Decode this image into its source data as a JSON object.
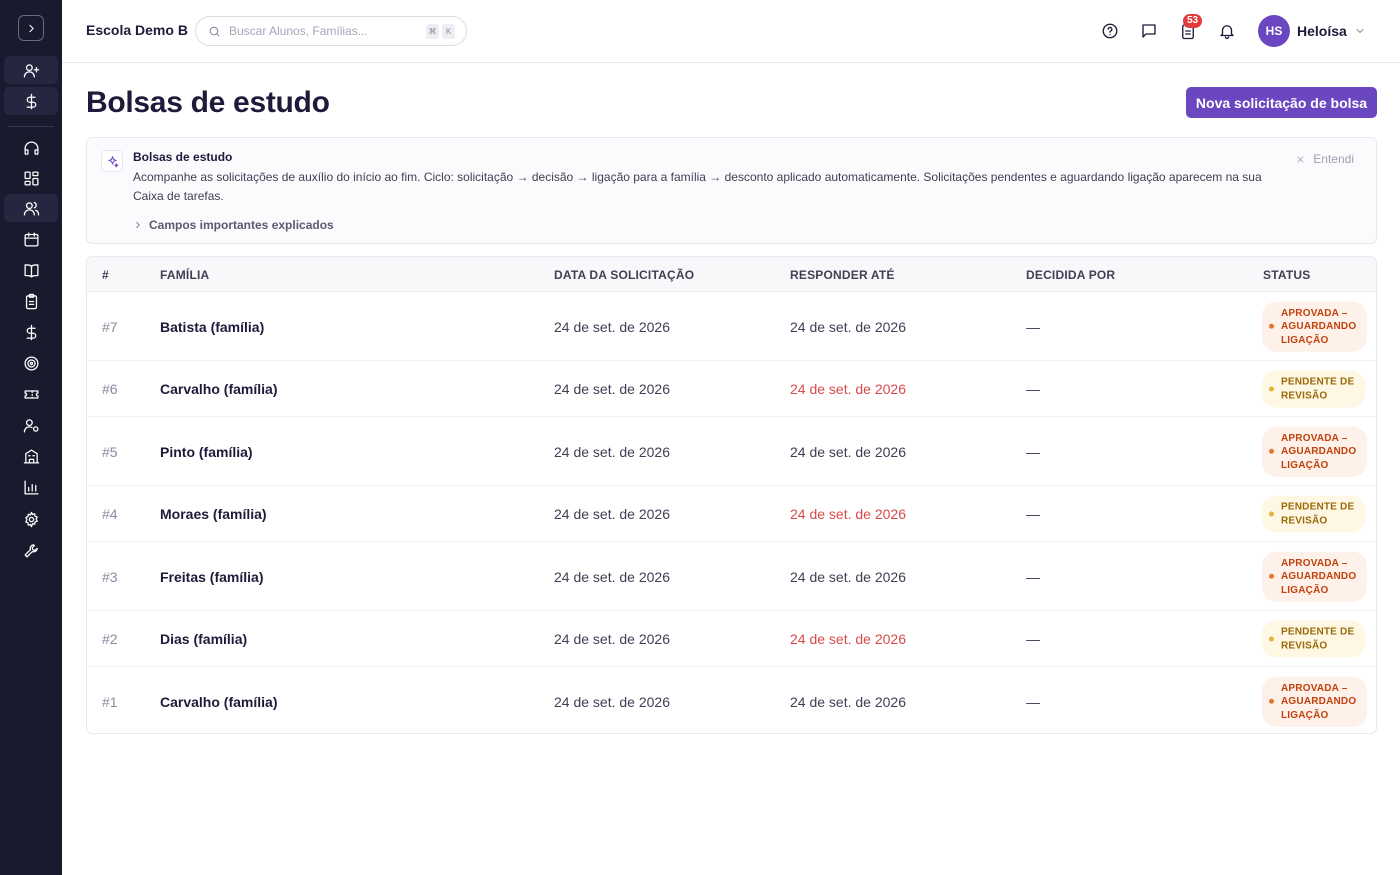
{
  "sidebar": {
    "items": [
      {
        "icon": "user-plus-icon"
      },
      {
        "icon": "dollar-icon"
      },
      {
        "icon": "headset-icon"
      },
      {
        "icon": "dashboard-icon"
      },
      {
        "icon": "users-icon"
      },
      {
        "icon": "calendar-icon"
      },
      {
        "icon": "book-icon"
      },
      {
        "icon": "clipboard-icon"
      },
      {
        "icon": "dollar-icon"
      },
      {
        "icon": "target-icon"
      },
      {
        "icon": "ticket-icon"
      },
      {
        "icon": "user-settings-icon"
      },
      {
        "icon": "building-icon"
      },
      {
        "icon": "bar-chart-icon"
      },
      {
        "icon": "gear-icon"
      },
      {
        "icon": "wrench-icon"
      }
    ]
  },
  "topbar": {
    "school_name": "Escola Demo B",
    "search_placeholder": "Buscar Alunos, Famílias...",
    "shortcut_keys": [
      "⌘",
      "K"
    ],
    "tasks_badge": "53",
    "user_initials": "HS",
    "user_name": "Heloísa"
  },
  "page": {
    "title": "Bolsas de estudo",
    "new_button": "Nova solicitação de bolsa"
  },
  "info": {
    "title": "Bolsas de estudo",
    "text": "Acompanhe as solicitações de auxílio do início ao fim. Ciclo: solicitação → decisão → ligação para a família → desconto aplicado automaticamente. Solicitações pendentes e aguardando ligação aparecem na sua Caixa de tarefas.",
    "expand_label": "Campos importantes explicados",
    "dismiss_label": "Entendi"
  },
  "table": {
    "headers": {
      "num": "#",
      "family": "FAMÍLIA",
      "request_date": "DATA DA SOLICITAÇÃO",
      "respond_by": "RESPONDER ATÉ",
      "decided_by": "DECIDIDA POR",
      "status": "STATUS"
    },
    "rows": [
      {
        "num": "#7",
        "family": "Batista (família)",
        "request_date": "24 de set. de 2026",
        "respond_by": "24 de set. de 2026",
        "respond_overdue": false,
        "decided_by": "—",
        "status": "APROVADA – AGUARDANDO LIGAÇÃO",
        "status_kind": "approved"
      },
      {
        "num": "#6",
        "family": "Carvalho (família)",
        "request_date": "24 de set. de 2026",
        "respond_by": "24 de set. de 2026",
        "respond_overdue": true,
        "decided_by": "—",
        "status": "PENDENTE DE REVISÃO",
        "status_kind": "pending"
      },
      {
        "num": "#5",
        "family": "Pinto (família)",
        "request_date": "24 de set. de 2026",
        "respond_by": "24 de set. de 2026",
        "respond_overdue": false,
        "decided_by": "—",
        "status": "APROVADA – AGUARDANDO LIGAÇÃO",
        "status_kind": "approved"
      },
      {
        "num": "#4",
        "family": "Moraes (família)",
        "request_date": "24 de set. de 2026",
        "respond_by": "24 de set. de 2026",
        "respond_overdue": true,
        "decided_by": "—",
        "status": "PENDENTE DE REVISÃO",
        "status_kind": "pending"
      },
      {
        "num": "#3",
        "family": "Freitas (família)",
        "request_date": "24 de set. de 2026",
        "respond_by": "24 de set. de 2026",
        "respond_overdue": false,
        "decided_by": "—",
        "status": "APROVADA – AGUARDANDO LIGAÇÃO",
        "status_kind": "approved"
      },
      {
        "num": "#2",
        "family": "Dias (família)",
        "request_date": "24 de set. de 2026",
        "respond_by": "24 de set. de 2026",
        "respond_overdue": true,
        "decided_by": "—",
        "status": "PENDENTE DE REVISÃO",
        "status_kind": "pending"
      },
      {
        "num": "#1",
        "family": "Carvalho (família)",
        "request_date": "24 de set. de 2026",
        "respond_by": "24 de set. de 2026",
        "respond_overdue": false,
        "decided_by": "—",
        "status": "APROVADA – AGUARDANDO LIGAÇÃO",
        "status_kind": "approved"
      }
    ]
  },
  "colors": {
    "sidebar_bg": "#1a1a2e",
    "accent": "#6b46c1",
    "overdue": "#d84a4a",
    "approved": "#c2410c",
    "pending": "#9a6a0a"
  }
}
